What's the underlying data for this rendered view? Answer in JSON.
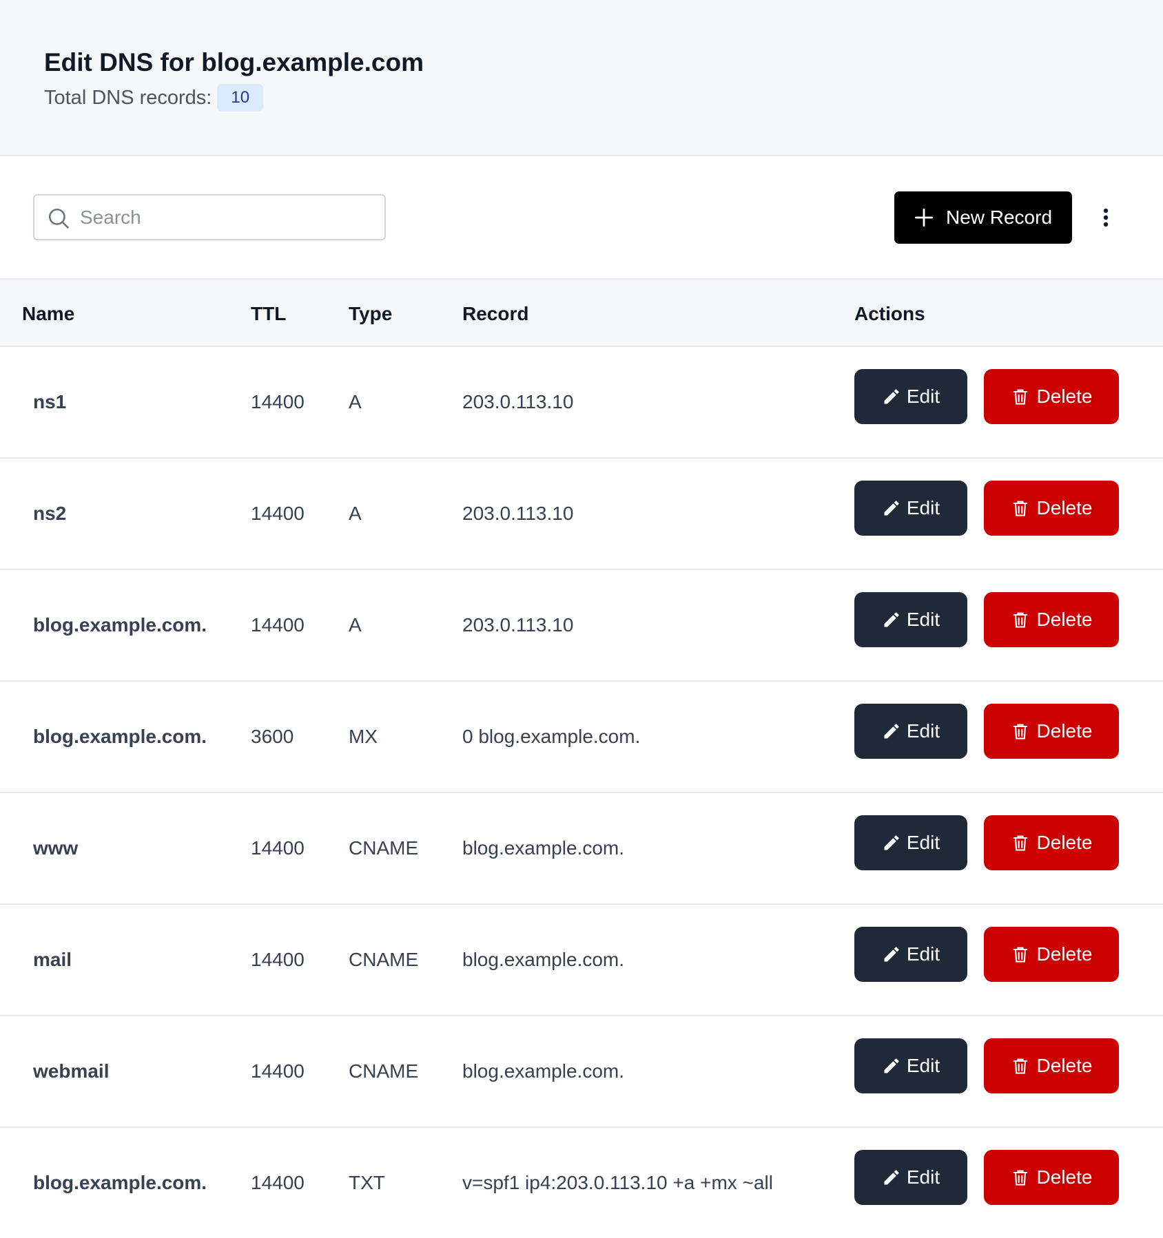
{
  "header": {
    "title": "Edit DNS for blog.example.com",
    "total_label": "Total DNS records:",
    "total_count": "10"
  },
  "toolbar": {
    "search_placeholder": "Search",
    "search_value": "",
    "new_record_label": "New Record"
  },
  "table": {
    "columns": {
      "name": "Name",
      "ttl": "TTL",
      "type": "Type",
      "record": "Record",
      "actions": "Actions"
    },
    "edit_label": "Edit",
    "delete_label": "Delete",
    "rows": [
      {
        "name": "ns1",
        "ttl": "14400",
        "type": "A",
        "record": "203.0.113.10"
      },
      {
        "name": "ns2",
        "ttl": "14400",
        "type": "A",
        "record": "203.0.113.10"
      },
      {
        "name": "blog.example.com.",
        "ttl": "14400",
        "type": "A",
        "record": "203.0.113.10"
      },
      {
        "name": "blog.example.com.",
        "ttl": "3600",
        "type": "MX",
        "record": "0 blog.example.com."
      },
      {
        "name": "www",
        "ttl": "14400",
        "type": "CNAME",
        "record": "blog.example.com."
      },
      {
        "name": "mail",
        "ttl": "14400",
        "type": "CNAME",
        "record": "blog.example.com."
      },
      {
        "name": "webmail",
        "ttl": "14400",
        "type": "CNAME",
        "record": "blog.example.com."
      },
      {
        "name": "blog.example.com.",
        "ttl": "14400",
        "type": "TXT",
        "record": "v=spf1 ip4:203.0.113.10 +a +mx ~all"
      }
    ]
  },
  "colors": {
    "edit_button": "#1f2937",
    "delete_button": "#cc0000",
    "new_record_button": "#000000",
    "count_badge": "#dbeafe"
  },
  "icons": {
    "search": "search-icon",
    "new_record": "plus-icon",
    "more_menu": "vertical-dots-icon",
    "edit": "pencil-icon",
    "delete": "trash-icon"
  }
}
